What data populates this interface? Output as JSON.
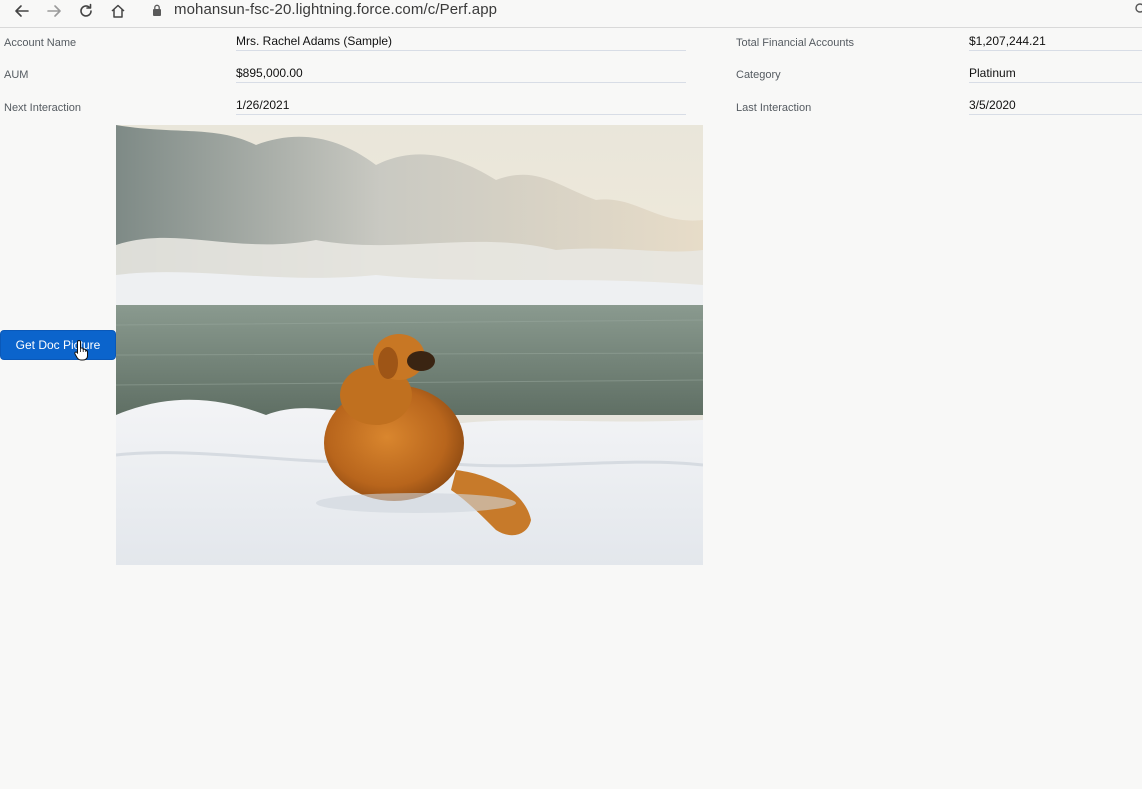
{
  "browser": {
    "url": "mohansun-fsc-20.lightning.force.com/c/Perf.app"
  },
  "fields": {
    "account_name": {
      "label": "Account Name",
      "value": "Mrs. Rachel Adams (Sample)"
    },
    "aum": {
      "label": "AUM",
      "value": "$895,000.00"
    },
    "next_interaction": {
      "label": "Next Interaction",
      "value": "1/26/2021"
    },
    "total_financial_accounts": {
      "label": "Total Financial Accounts",
      "value": "$1,207,244.21"
    },
    "category": {
      "label": "Category",
      "value": "Platinum"
    },
    "last_interaction": {
      "label": "Last Interaction",
      "value": "3/5/2020"
    }
  },
  "actions": {
    "get_doc_picture_label": "Get Doc Picture"
  },
  "image": {
    "subject": "golden dog lying in snow by a river"
  },
  "colors": {
    "button_bg": "#0b64cc",
    "button_text": "#ffffff",
    "page_bg": "#f8f8f7"
  }
}
